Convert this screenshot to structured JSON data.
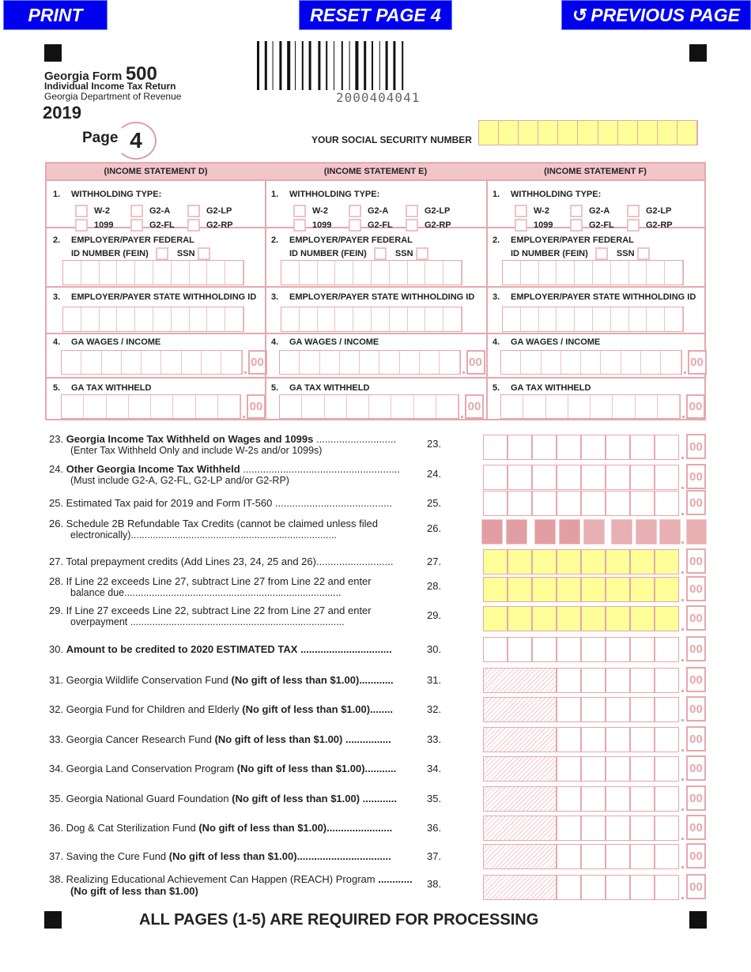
{
  "buttons": {
    "print": "PRINT",
    "reset": "RESET PAGE 4",
    "previous": "PREVIOUS PAGE"
  },
  "header": {
    "form_prefix": "Georgia Form",
    "form_number": "500",
    "subtitle": "Individual Income Tax Return",
    "dept": "Georgia Department of Revenue",
    "year": "2019",
    "page_label": "Page",
    "page_number": "4",
    "barcode_number": "2000404041",
    "ssn_label": "YOUR SOCIAL SECURITY NUMBER"
  },
  "statements": [
    {
      "title": "(INCOME STATEMENT D)"
    },
    {
      "title": "(INCOME STATEMENT E)"
    },
    {
      "title": "(INCOME STATEMENT F)"
    }
  ],
  "statement_fields": {
    "n1": "1.",
    "withholding_type": "WITHHOLDING TYPE:",
    "types": [
      "W-2",
      "G2-A",
      "G2-LP",
      "1099",
      "G2-FL",
      "G2-RP"
    ],
    "n2": "2.",
    "fein_label_1": "EMPLOYER/PAYER FEDERAL",
    "fein_label_2": "ID NUMBER (FEIN)",
    "ssn": "SSN",
    "n3": "3.",
    "state_id": "EMPLOYER/PAYER STATE WITHHOLDING ID",
    "n4": "4.",
    "wages": "GA WAGES / INCOME",
    "n5": "5.",
    "tax_withheld": "GA TAX WITHHELD",
    "cents": "00"
  },
  "lines": [
    {
      "num": "23.",
      "text": "23. ",
      "bold": "Georgia Income Tax Withheld on Wages and 1099s",
      "rest": " ............................",
      "sub": "(Enter Tax Withheld Only and include W-2s and/or 1099s)",
      "style": "white"
    },
    {
      "num": "24.",
      "text": "24. ",
      "bold": "Other Georgia Income Tax Withheld",
      "rest": " .......................................................",
      "sub": "(Must include G2-A, G2-FL, G2-LP and/or G2-RP)",
      "style": "white"
    },
    {
      "num": "25.",
      "text": "25. Estimated Tax paid for 2019 and Form IT-560 .........................................",
      "style": "white"
    },
    {
      "num": "26.",
      "text": "26. Schedule 2B Refundable Tax Credits (cannot be claimed unless filed",
      "sub": "electronically)...........................................................................",
      "style": "dark"
    },
    {
      "num": "27.",
      "text": "27. Total prepayment credits (Add Lines 23, 24, 25 and 26)...........................",
      "style": "yellow"
    },
    {
      "num": "28.",
      "text": "28.  If Line 22 exceeds Line 27, subtract Line 27 from Line 22 and enter",
      "sub": "balance due...............................................................................",
      "style": "yellow"
    },
    {
      "num": "29.",
      "text": "29.  If Line 27 exceeds Line 22, subtract Line 22 from Line 27 and enter",
      "sub": "overpayment ..............................................................................",
      "style": "yellow"
    },
    {
      "num": "30.",
      "text": "30. ",
      "bold": "Amount to be credited to 2020 ESTIMATED TAX ................................",
      "style": "white"
    },
    {
      "num": "31.",
      "text": "31. Georgia Wildlife Conservation Fund ",
      "bold": "(No gift of less than $1.00)............",
      "style": "hatch"
    },
    {
      "num": "32.",
      "text": "32. Georgia Fund for Children and Elderly ",
      "bold": "(No gift of less than $1.00)........",
      "style": "hatch"
    },
    {
      "num": "33.",
      "text": "33. Georgia Cancer Research Fund ",
      "bold": "(No gift of less than $1.00) ................",
      "style": "hatch"
    },
    {
      "num": "34.",
      "text": "34. Georgia Land Conservation Program ",
      "bold": "(No gift of less than $1.00)...........",
      "style": "hatch"
    },
    {
      "num": "35.",
      "text": "35. Georgia National Guard Foundation ",
      "bold": "(No gift of less than $1.00) ............",
      "style": "hatch"
    },
    {
      "num": "36.",
      "text": "36. Dog & Cat Sterilization Fund ",
      "bold": "(No gift of less than $1.00).......................",
      "style": "hatch"
    },
    {
      "num": "37.",
      "text": "37. Saving the Cure Fund  ",
      "bold": "(No gift of less than $1.00).................................",
      "style": "hatch"
    },
    {
      "num": "38.",
      "text": "38. Realizing Educational Achievement Can Happen (REACH) Program ",
      "bold": "............",
      "sub_bold": "(No gift of less than $1.00)",
      "style": "hatch"
    }
  ],
  "footer": "ALL PAGES (1-5) ARE REQUIRED FOR PROCESSING",
  "colors": {
    "button": "#0000ee",
    "form_pink": "#e7a7ad",
    "header_pink": "#f2c6c9",
    "ssn_yellow": "#ffff99"
  }
}
